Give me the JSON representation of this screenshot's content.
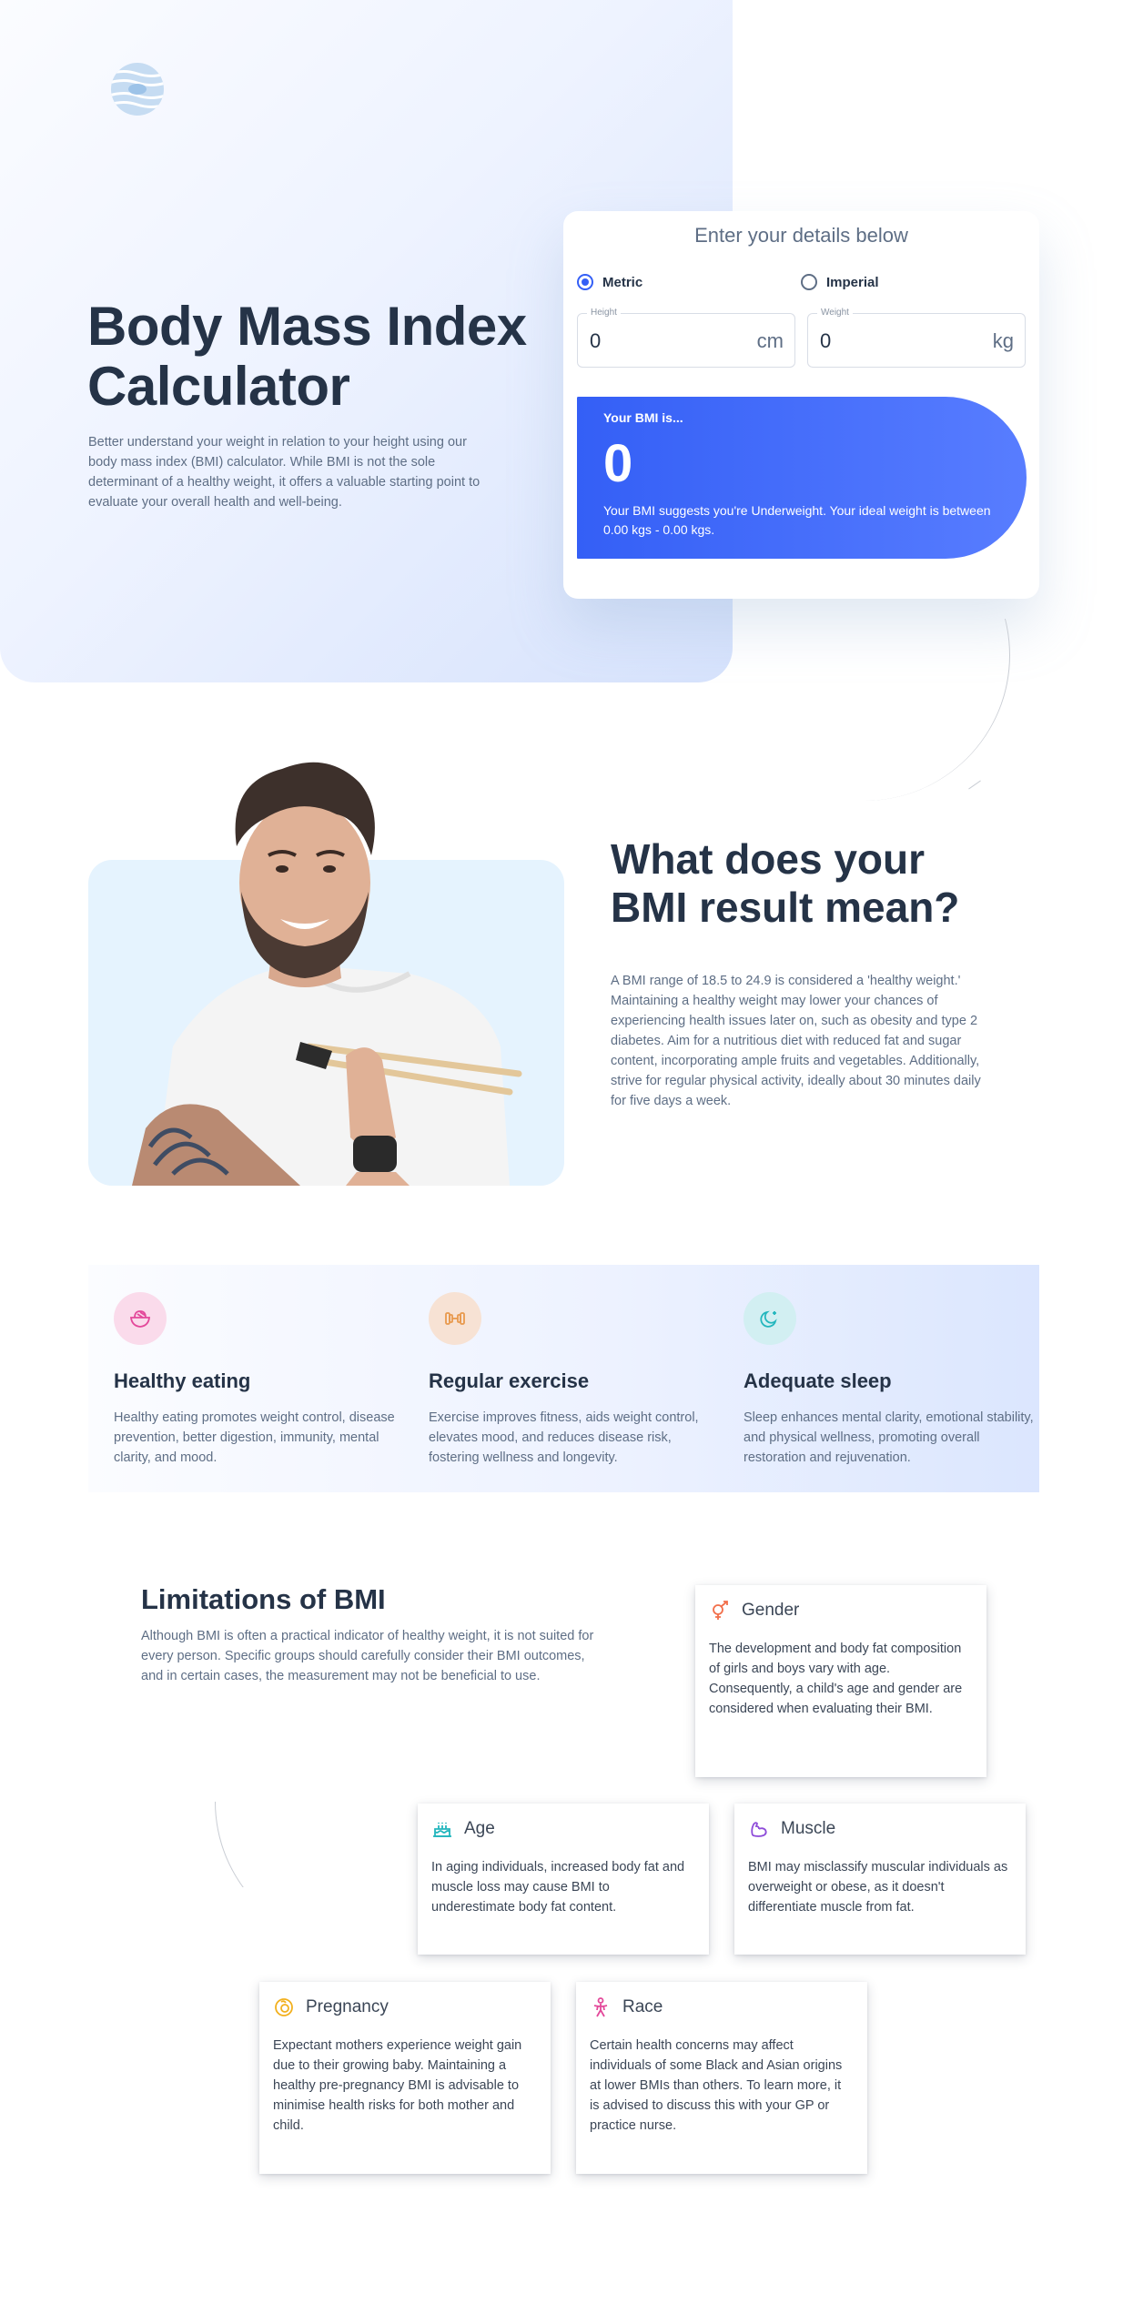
{
  "hero": {
    "title": "Body Mass Index Calculator",
    "description": "Better understand your weight in relation to your height using our body mass index (BMI) calculator. While BMI is not the sole determinant of a healthy weight, it offers a valuable starting point to evaluate your overall health and well-being."
  },
  "calculator": {
    "heading": "Enter your details below",
    "units": {
      "metric_label": "Metric",
      "imperial_label": "Imperial",
      "selected": "Metric"
    },
    "height": {
      "label": "Height",
      "value": "0",
      "unit": "cm"
    },
    "weight": {
      "label": "Weight",
      "value": "0",
      "unit": "kg"
    },
    "result": {
      "label": "Your BMI is...",
      "value": "0",
      "message": "Your BMI suggests you're Underweight. Your ideal weight is between 0.00 kgs - 0.00 kgs."
    }
  },
  "meaning": {
    "title": "What does your BMI result mean?",
    "text": "A BMI range of 18.5 to 24.9 is considered a 'healthy weight.' Maintaining a healthy weight may lower your chances of experiencing health issues later on, such as obesity and type 2 diabetes. Aim for a nutritious diet with reduced fat and sugar content, incorporating ample fruits and vegetables. Additionally, strive for regular physical activity, ideally about 30 minutes daily for five days a week."
  },
  "benefits": [
    {
      "title": "Healthy eating",
      "text": "Healthy eating promotes weight control, disease prevention, better digestion, immunity, mental clarity, and mood.",
      "icon": "bowl-icon",
      "color": "#e3489a",
      "bg": "#fadbeb"
    },
    {
      "title": "Regular exercise",
      "text": "Exercise improves fitness, aids weight control, elevates mood, and reduces disease risk, fostering wellness and longevity.",
      "icon": "dumbbell-icon",
      "color": "#e8994d",
      "bg": "#f7e2d4"
    },
    {
      "title": "Adequate sleep",
      "text": "Sleep enhances mental clarity, emotional stability, and physical wellness, promoting overall restoration and rejuvenation.",
      "icon": "moon-icon",
      "color": "#23b6bd",
      "bg": "#d2eff2"
    }
  ],
  "limitations": {
    "title": "Limitations of BMI",
    "text": "Although BMI is often a practical indicator of healthy weight, it is not suited for every person. Specific groups should carefully consider their BMI outcomes, and in certain cases, the measurement may not be beneficial to use.",
    "cards": [
      {
        "name": "Gender",
        "text": "The development and body fat composition of girls and boys vary with age. Consequently, a child's age and gender are considered when evaluating their BMI.",
        "icon": "gender-icon",
        "color": "#f26f4b"
      },
      {
        "name": "Age",
        "text": "In aging individuals, increased body fat and muscle loss may cause BMI to underestimate body fat content.",
        "icon": "cake-icon",
        "color": "#23b6bd"
      },
      {
        "name": "Muscle",
        "text": "BMI may misclassify muscular individuals as overweight or obese, as it doesn't differentiate muscle from fat.",
        "icon": "muscle-icon",
        "color": "#8e4cd9"
      },
      {
        "name": "Pregnancy",
        "text": "Expectant mothers experience weight gain due to their growing baby. Maintaining a healthy pre-pregnancy BMI is advisable to minimise health risks for both mother and child.",
        "icon": "pregnancy-icon",
        "color": "#f2b01e"
      },
      {
        "name": "Race",
        "text": "Certain health concerns may affect individuals of some Black and Asian origins at lower BMIs than others. To learn more, it is advised to discuss this with your GP or practice nurse.",
        "icon": "person-icon",
        "color": "#e3489a"
      }
    ]
  }
}
